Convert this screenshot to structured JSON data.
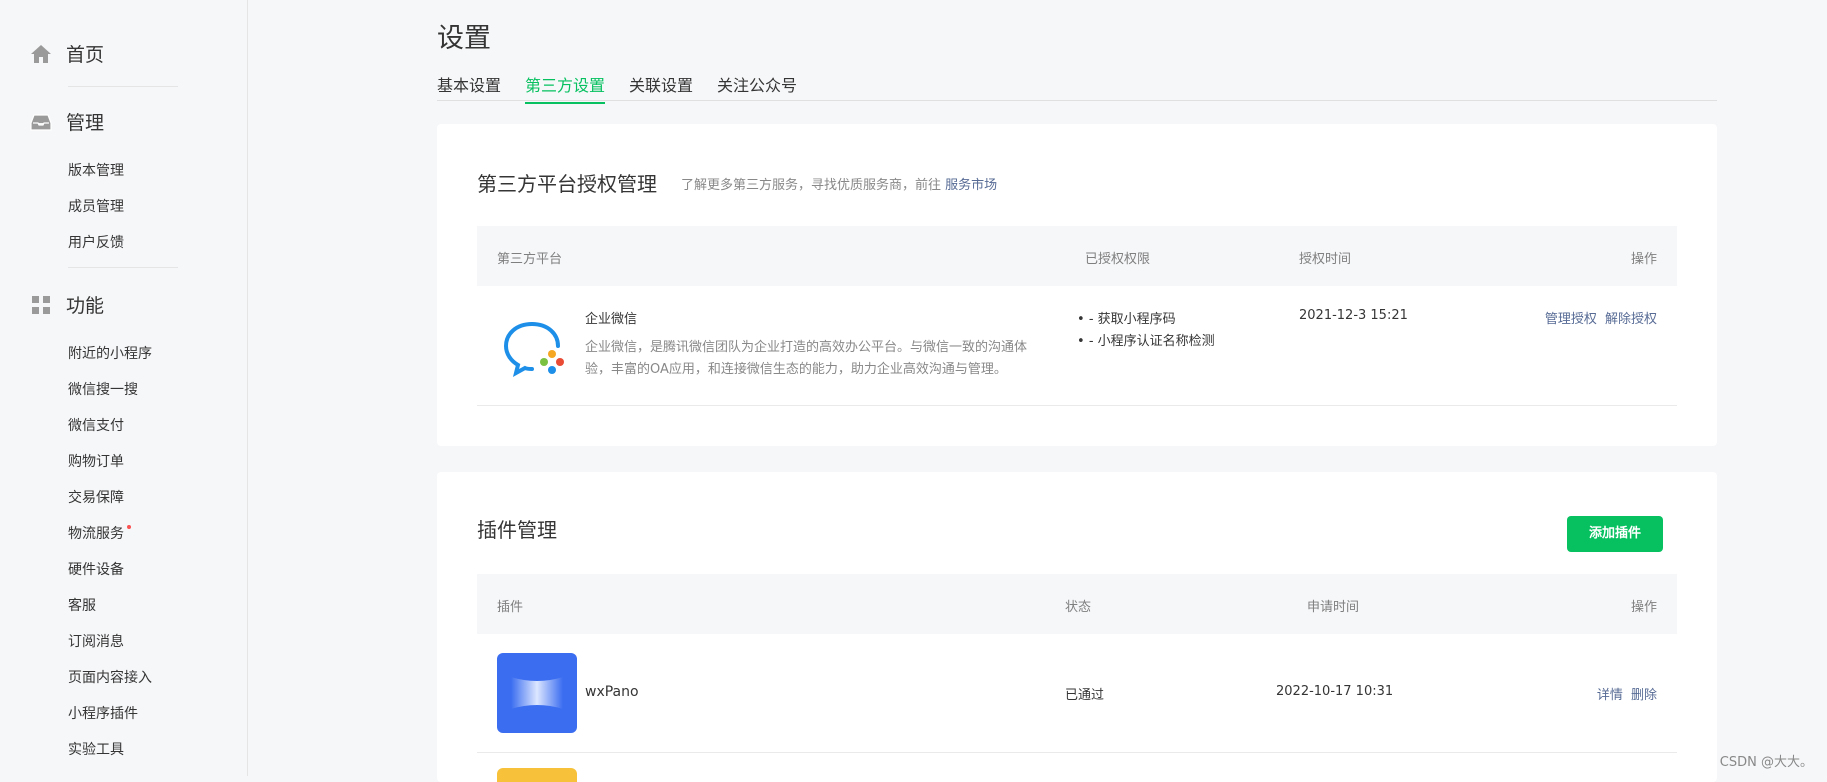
{
  "sidebar": {
    "home_label": "首页",
    "manage_label": "管理",
    "manage_items": [
      "版本管理",
      "成员管理",
      "用户反馈"
    ],
    "features_label": "功能",
    "feature_items": [
      "附近的小程序",
      "微信搜一搜",
      "微信支付",
      "购物订单",
      "交易保障",
      "物流服务",
      "硬件设备",
      "客服",
      "订阅消息",
      "页面内容接入",
      "小程序插件",
      "实验工具"
    ]
  },
  "page": {
    "title": "设置",
    "tabs": [
      "基本设置",
      "第三方设置",
      "关联设置",
      "关注公众号"
    ],
    "active_tab": "第三方设置"
  },
  "third_party": {
    "title": "第三方平台授权管理",
    "subtitle": "了解更多第三方服务，寻找优质服务商，前往",
    "subtitle_link": "服务市场",
    "columns": [
      "第三方平台",
      "已授权权限",
      "授权时间",
      "操作"
    ],
    "rows": [
      {
        "name": "企业微信",
        "desc_line1": "企业微信，是腾讯微信团队为企业打造的高效办公平台。与微信一致的沟通体",
        "desc_line2": "验，丰富的OA应用，和连接微信生态的能力，助力企业高效沟通与管理。",
        "permissions": [
          "- 获取小程序码",
          "- 小程序认证名称检测"
        ],
        "time": "2021-12-3 15:21",
        "actions": [
          "管理授权",
          "解除授权"
        ]
      }
    ]
  },
  "plugins": {
    "title": "插件管理",
    "add_button": "添加插件",
    "columns": [
      "插件",
      "状态",
      "申请时间",
      "操作"
    ],
    "rows": [
      {
        "name": "wxPano",
        "status": "已通过",
        "time": "2022-10-17 10:31",
        "actions": [
          "详情",
          "删除"
        ]
      }
    ]
  },
  "watermark": "CSDN @大大。",
  "colors": {
    "accent": "#07c160",
    "link": "#576b95",
    "background": "#f6f7f9"
  }
}
